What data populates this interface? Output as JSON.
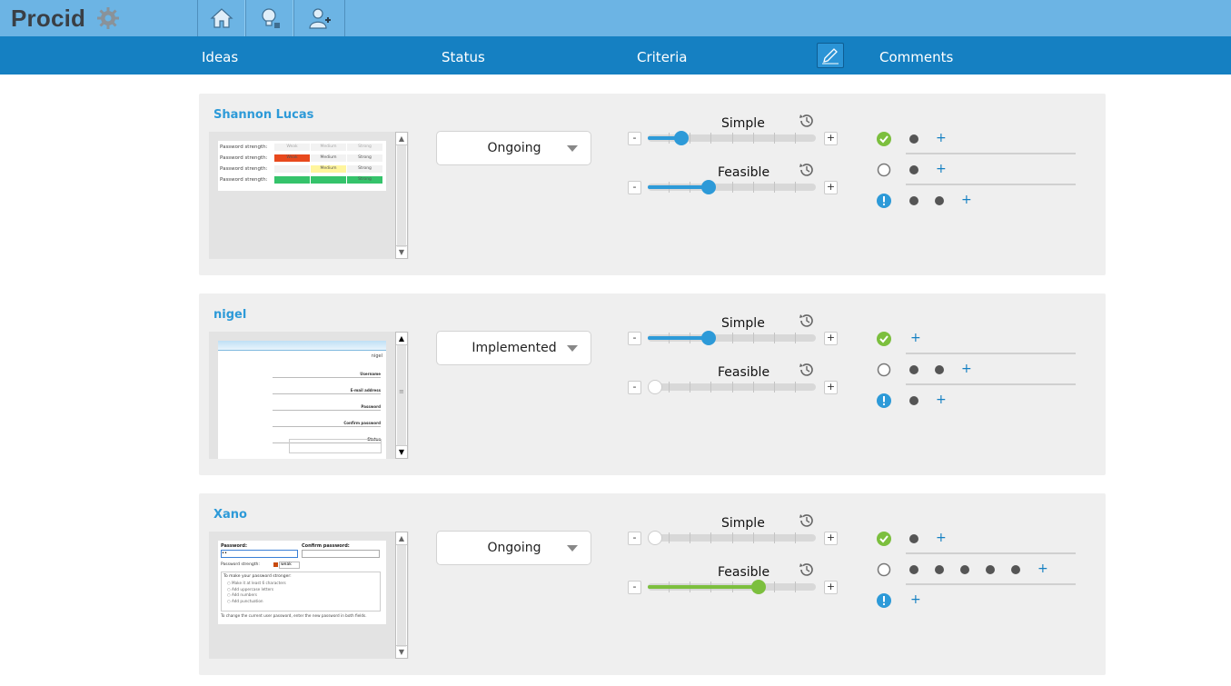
{
  "app": {
    "name": "Procid"
  },
  "colors": {
    "topbar": "#6cb4e4",
    "subbar": "#1580c2",
    "accent_blue": "#2d9ad8",
    "green": "#7cbf3e"
  },
  "nav": [
    {
      "name": "home",
      "icon": "home-icon"
    },
    {
      "name": "ideas",
      "icon": "lightbulb-icon"
    },
    {
      "name": "add-user",
      "icon": "add-user-icon"
    }
  ],
  "columns": {
    "ideas": "Ideas",
    "status": "Status",
    "criteria": "Criteria",
    "comments": "Comments",
    "edit_icon": "pencil-icon"
  },
  "ideas": [
    {
      "author": "Shannon Lucas",
      "status": "Ongoing",
      "criteria": [
        {
          "label": "Simple",
          "value": 0.2,
          "color": "blue"
        },
        {
          "label": "Feasible",
          "value": 0.36,
          "color": "blue"
        }
      ],
      "comments": {
        "positive": 1,
        "neutral": 1,
        "negative": 2,
        "plus": "+"
      },
      "thumbnail": {
        "rows": [
          {
            "label": "Password strength:",
            "cells": [
              "Weak",
              "Medium",
              "Strong"
            ]
          },
          {
            "label": "Password strength:",
            "cells": [
              "Weak",
              "Medium",
              "Strong"
            ]
          },
          {
            "label": "Password strength:",
            "cells": [
              "",
              "Medium",
              "Strong"
            ]
          },
          {
            "label": "Password strength:",
            "cells": [
              "",
              "",
              "Strong"
            ]
          }
        ]
      }
    },
    {
      "author": "nigel",
      "status": "Implemented",
      "criteria": [
        {
          "label": "Simple",
          "value": 0.36,
          "color": "blue"
        },
        {
          "label": "Feasible",
          "value": 0.0,
          "color": "white"
        }
      ],
      "comments": {
        "positive": 0,
        "neutral": 2,
        "negative": 1,
        "plus": "+"
      },
      "thumbnail": {
        "user": "nigel",
        "fields": [
          "Username",
          "E-mail address",
          "Password",
          "Confirm password",
          "Status"
        ]
      }
    },
    {
      "author": "Xano",
      "status": "Ongoing",
      "criteria": [
        {
          "label": "Simple",
          "value": 0.0,
          "color": "white"
        },
        {
          "label": "Feasible",
          "value": 0.66,
          "color": "green"
        }
      ],
      "comments": {
        "positive": 1,
        "neutral": 5,
        "negative": 0,
        "plus": "+"
      },
      "thumbnail": {
        "password_label": "Password:",
        "confirm_label": "Confirm password:",
        "strength_label": "Password strength:",
        "strength_value": "weak",
        "tips_title": "To make your password stronger:",
        "tips": [
          "Make it at least 6 characters",
          "Add uppercase letters",
          "Add numbers",
          "Add punctuation"
        ],
        "footer": "To change the current user password, enter the new password in both fields."
      }
    }
  ],
  "slider_controls": {
    "minus": "-",
    "plus": "+"
  }
}
